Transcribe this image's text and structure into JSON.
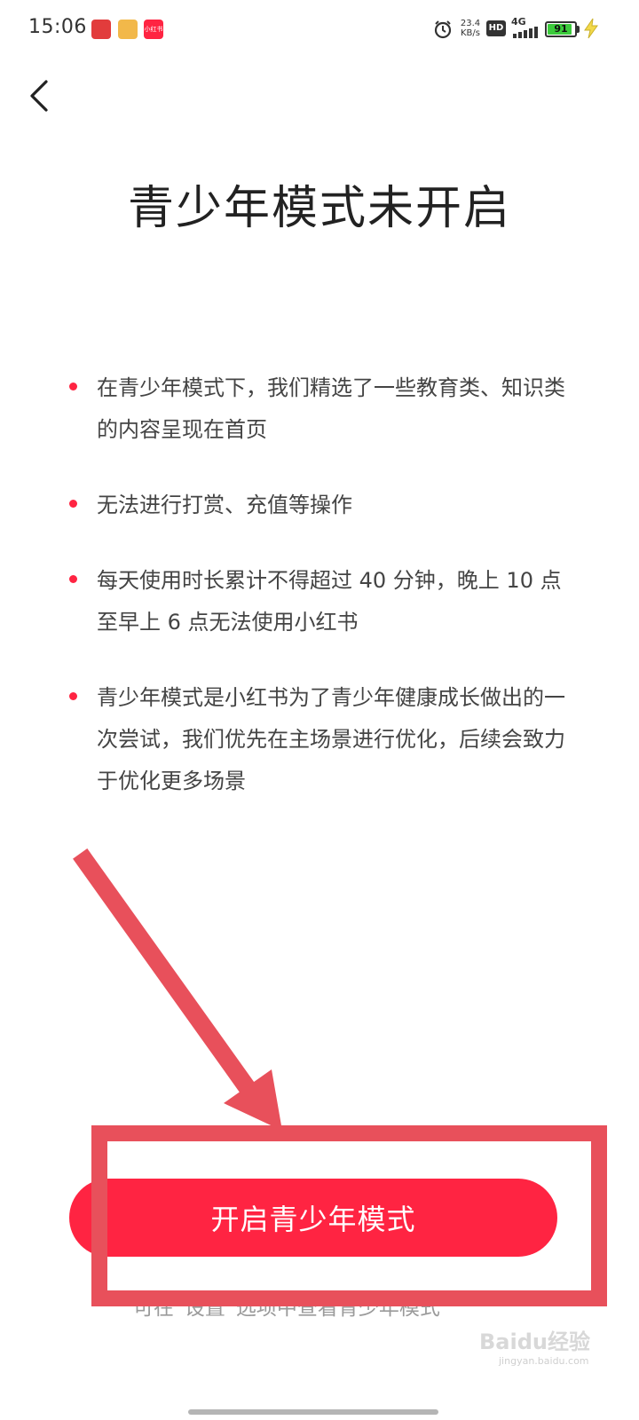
{
  "status_bar": {
    "time": "15:06",
    "notifications": [
      {
        "icon": "app-icon-1",
        "label": ""
      },
      {
        "icon": "app-icon-2",
        "label": ""
      },
      {
        "icon": "xiaohongshu-icon",
        "label": "小红书"
      }
    ],
    "speed_value": "23.4",
    "speed_unit": "KB/s",
    "hd": "HD",
    "network": "4G",
    "battery_level": "91",
    "battery_fraction": 0.91
  },
  "page": {
    "title": "青少年模式未开启",
    "bullets": [
      "在青少年模式下，我们精选了一些教育类、知识类的内容呈现在首页",
      "无法进行打赏、充值等操作",
      "每天使用时长累计不得超过 40 分钟，晚上 10 点至早上 6 点无法使用小红书",
      "青少年模式是小红书为了青少年健康成长做出的一次尝试，我们优先在主场景进行优化，后续会致力于优化更多场景"
    ],
    "button_label": "开启青少年模式",
    "footnote": "可在“设置”选项中查看青少年模式"
  },
  "watermark": {
    "text": "Baidu经验",
    "sub": "jingyan.baidu.com"
  },
  "colors": {
    "accent": "#ff2442",
    "annotation": "#e8505b"
  }
}
